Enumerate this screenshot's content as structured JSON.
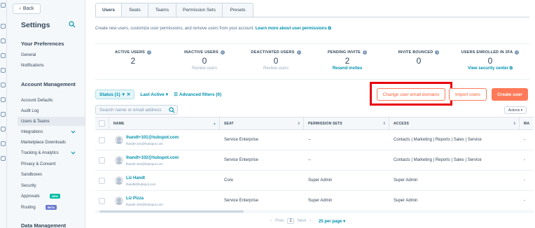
{
  "sidebar": {
    "back_label": "Back",
    "title": "Settings",
    "sections": [
      {
        "title": "Your Preferences",
        "items": [
          {
            "label": "General"
          },
          {
            "label": "Notifications"
          }
        ]
      },
      {
        "title": "Account Management",
        "items": [
          {
            "label": "Account Defaults"
          },
          {
            "label": "Audit Log"
          },
          {
            "label": "Users & Teams",
            "active": true
          },
          {
            "label": "Integrations",
            "expandable": true
          },
          {
            "label": "Marketplace Downloads"
          },
          {
            "label": "Tracking & Analytics",
            "expandable": true
          },
          {
            "label": "Privacy & Consent"
          },
          {
            "label": "Sandboxes"
          },
          {
            "label": "Security"
          },
          {
            "label": "Approvals",
            "badge": "NEW"
          },
          {
            "label": "Routing",
            "badge": "BETA"
          }
        ]
      },
      {
        "title": "Data Management",
        "items": []
      }
    ]
  },
  "tabs": [
    {
      "label": "Users",
      "active": true
    },
    {
      "label": "Seats"
    },
    {
      "label": "Teams"
    },
    {
      "label": "Permission Sets"
    },
    {
      "label": "Presets"
    }
  ],
  "intro": {
    "text": "Create new users, customize user permissions, and remove users from your account.",
    "link": "Learn more about user permissions"
  },
  "stats": [
    {
      "label": "ACTIVE USERS",
      "value": "2",
      "link": ""
    },
    {
      "label": "INACTIVE USERS",
      "value": "0",
      "link": "Review users"
    },
    {
      "label": "DEACTIVATED USERS",
      "value": "0",
      "link": "Review users"
    },
    {
      "label": "PENDING INVITE",
      "value": "2",
      "link": "Resend invites",
      "link_active": true
    },
    {
      "label": "INVITE BOUNCED",
      "value": "0",
      "link": ""
    },
    {
      "label": "USERS ENROLLED IN 2FA",
      "value": "0",
      "link": "View security center",
      "link_active": true
    }
  ],
  "filters": {
    "status": "Status (1)",
    "last_active": "Last Active",
    "advanced": "Advanced filters (0)"
  },
  "buttons": {
    "change_domains": "Change user email domains",
    "import": "Import users",
    "create": "Create user",
    "actions": "Actions"
  },
  "search": {
    "placeholder": "Search name or email address"
  },
  "table": {
    "columns": [
      "NAME",
      "SEAT",
      "PERMISSION SETS",
      "ACCESS",
      "MA"
    ],
    "rows": [
      {
        "name": "lhandt+101@hubspot.com",
        "email": "lhandt+101@hubspot.com",
        "seat": "Service Enterprise",
        "permission": "--",
        "access": [
          "Contacts",
          "Marketing",
          "Reports",
          "Sales",
          "Service"
        ]
      },
      {
        "name": "lhandt+102@hubspot.com",
        "email": "lhandt+102@hubspot.com",
        "seat": "Service Enterprise",
        "permission": "--",
        "access": [
          "Contacts",
          "Marketing",
          "Reports",
          "Sales",
          "Service"
        ]
      },
      {
        "name": "Liz Handt",
        "email": "lhandt@hubspot.com",
        "seat": "Core",
        "permission": "Super Admin",
        "access": [
          "Super Admin"
        ]
      },
      {
        "name": "Liz Pizza",
        "email": "lhandt+100@hubspot.com",
        "seat": "Service Enterprise",
        "permission": "Super Admin",
        "access": [
          "Super Admin"
        ]
      }
    ]
  },
  "pagination": {
    "prev": "Prev",
    "current": "1",
    "next": "Next",
    "per_page": "25 per page"
  },
  "colors": {
    "accent": "#ff7a59",
    "link": "#0091ae",
    "highlight": "#e8000b",
    "text": "#33475b"
  }
}
